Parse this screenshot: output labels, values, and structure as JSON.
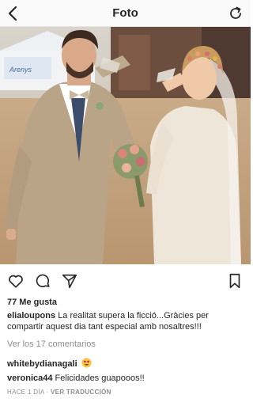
{
  "header": {
    "title": "Foto"
  },
  "post": {
    "image_alt": "",
    "banner_text": "Arenys",
    "likes": "77 Me gusta",
    "author": "elialoupons",
    "caption": "La realitat supera la ficció...Gràcies per compartir aquest dia tant especial amb nosaltres!!!",
    "view_comments": "Ver los 17 comentarios"
  },
  "comments": [
    {
      "user": "whitebydianagali",
      "text": "",
      "emoji": "heart-eyes-emoji"
    },
    {
      "user": "veronica44",
      "text": "Felicidades guapooos!!"
    }
  ],
  "meta": {
    "time": "HACE 1 DÍA",
    "separator": "·",
    "translate": "VER TRADUCCIÓN"
  },
  "icons": {
    "back": "chevron-left-icon",
    "refresh": "refresh-icon",
    "like": "heart-icon",
    "comment": "comment-icon",
    "share": "send-icon",
    "save": "bookmark-icon"
  },
  "colors": {
    "text": "#262626",
    "muted": "#8e8e8e",
    "header_bg": "#fafafa"
  }
}
